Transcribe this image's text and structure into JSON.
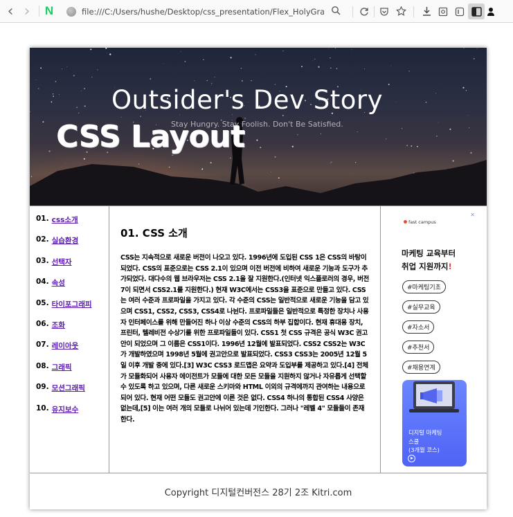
{
  "browser": {
    "url": "file:///C:/Users/hushe/Desktop/css_presentation/Flex_HolyGrail/Fl",
    "nav_back_glyph": "‹",
    "nav_forward_glyph": "›"
  },
  "hero": {
    "site_title": "Outsider's Dev Story",
    "site_subtitle": "Stay Hungry. Stay Foolish. Don't Be Satisfied.",
    "heading": "CSS Layout"
  },
  "nav": {
    "items": [
      {
        "num": "01.",
        "label": "css소개"
      },
      {
        "num": "02.",
        "label": "실습환경"
      },
      {
        "num": "03.",
        "label": "선택자"
      },
      {
        "num": "04.",
        "label": "속성"
      },
      {
        "num": "05.",
        "label": "타이포그래피"
      },
      {
        "num": "06.",
        "label": "조화"
      },
      {
        "num": "07.",
        "label": "레이아웃"
      },
      {
        "num": "08.",
        "label": "그래픽"
      },
      {
        "num": "09.",
        "label": "모션그래픽"
      },
      {
        "num": "10.",
        "label": "유지보수"
      }
    ]
  },
  "article": {
    "title": "01. CSS 소개",
    "body": "CSS는 지속적으로 새로운 버전이 나오고 있다. 1996년에 도입된 CSS 1은 CSS의 바탕이 되었다. CSS의 표준으로는 CSS 2.1이 있으며 이전 버전에 비하여 새로운 기능과 도구가 추가되었다. 대다수의 웹 브라우저는 CSS 2.1을 잘 지원한다.(인터넷 익스플로러의 경우, 버전 7이 되면서 CSS2.1를 지원한다.) 현재 W3C에서는 CSS3을 표준으로 만들고 있다. CSS는 여러 수준과 프로파일을 가지고 있다. 각 수준의 CSS는 일반적으로 새로운 기능을 담고 있으며 CSS1, CSS2, CSS3, CSS4로 나뉜다. 프로파일들은 일반적으로 특정한 장치나 사용자 인터페이스를 위해 만들어진 하나 이상 수준의 CSS의 하부 집합이다. 현재 휴대용 장치, 프린터, 텔레비전 수상기를 위한 프로파일들이 있다. CSS1 첫 CSS 규격은 공식 W3C 권고안이 되었으며 그 이름은 CSS1이다. 1996년 12월에 발표되었다. CSS2 CSS2는 W3C가 개발하였으며 1998년 5월에 권고안으로 발표되었다. CSS3 CSS3는 2005년 12월 5일 이후 개발 중에 있다.[3] W3C CSS3 로드맵은 요약과 도입부를 제공하고 있다.[4] 전체가 모듈화되어 사용자 에이전트가 모듈에 대한 모든 모듈을 지원하지 않거나 자유롭게 선택할 수 있도록 하고 있으며, 다른 새로운 스키마와 HTML 이외의 규격에까지 관여하는 내용으로 되어 있다. 현재 어떤 모듈도 권고안에 이른 것은 없다. CSS4 하나의 통합된 CSS4 사양은 없는데,[5] 이는 여러 개의 모듈로 나뉘어 있는데 기인한다. 그러나 \"레벨 4\" 모듈들이 존재한다."
  },
  "ad": {
    "close_glyph": "✕",
    "brand": "fast campus",
    "title_line1": "마케팅 교육부터",
    "title_line2": "취업 지원까지",
    "title_mark": "!",
    "tags": [
      "#마케팅기초",
      "#실무교육",
      "#자소서",
      "#추천서",
      "#채용연계"
    ],
    "card_line1": "디지털 마케팅",
    "card_line2": "스쿨",
    "card_line3": "(3개월 코스)"
  },
  "footer": {
    "text": "Copyright 디지털컨버전스 28기 2조 Kitri.com"
  }
}
